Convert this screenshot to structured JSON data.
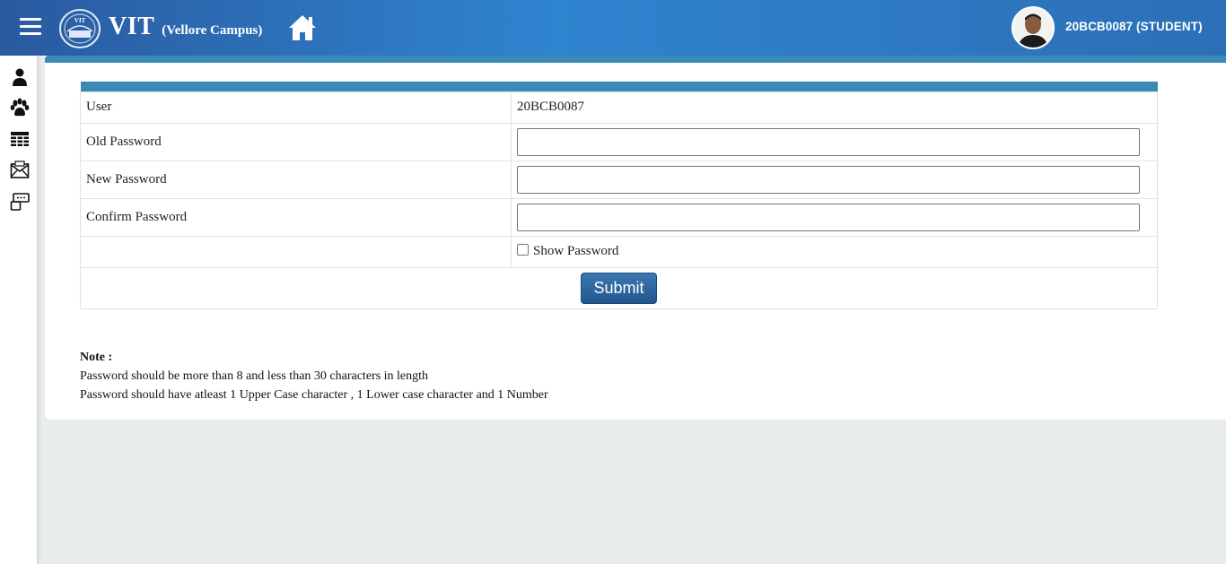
{
  "header": {
    "brand": "VIT",
    "campus": "(Vellore Campus)",
    "user_label": "20BCB0087 (STUDENT)",
    "bg_color": "#2f84cf"
  },
  "sidebar": {
    "icons": [
      "person-icon",
      "paw-icon",
      "table-icon",
      "mail-icon",
      "form-icon"
    ]
  },
  "form": {
    "accent": "#3a8ab8",
    "user_label": "User",
    "user_value": "20BCB0087",
    "old_password_label": "Old Password",
    "old_password_value": "",
    "new_password_label": "New Password",
    "new_password_value": "",
    "confirm_password_label": "Confirm Password",
    "confirm_password_value": "",
    "show_password_label": "Show Password",
    "show_password_checked": false,
    "submit_label": "Submit"
  },
  "note": {
    "title": "Note :",
    "line1": "Password should be more than 8 and less than 30 characters in length",
    "line2": "Password should have atleast 1 Upper Case character , 1 Lower case character and 1 Number"
  }
}
